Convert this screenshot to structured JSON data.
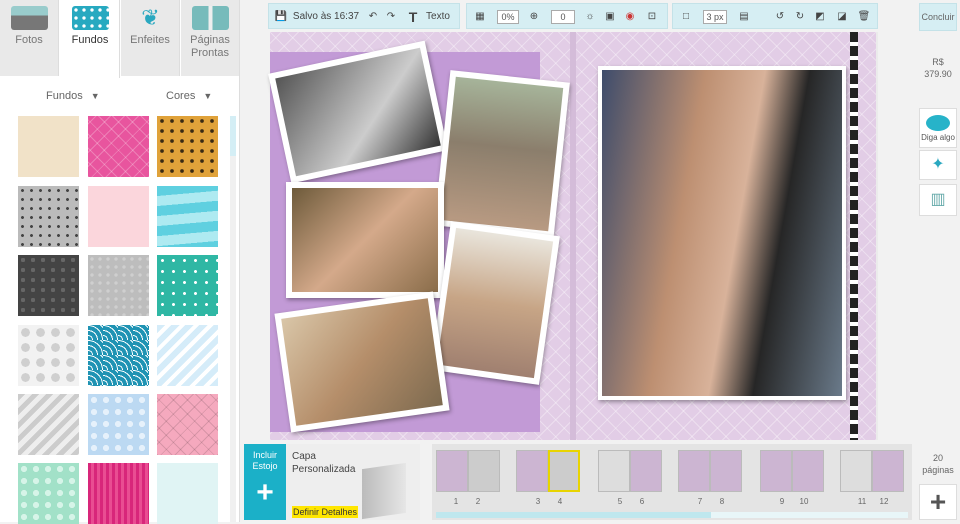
{
  "tabs": [
    {
      "label": "Fotos"
    },
    {
      "label": "Fundos"
    },
    {
      "label": "Enfeites"
    },
    {
      "label": "Páginas Prontas"
    }
  ],
  "filters": {
    "backgrounds": "Fundos",
    "colors": "Cores"
  },
  "toolbar": {
    "saved": "Salvo às 16:37",
    "text": "Texto",
    "opacity": "0%",
    "zoom": "0",
    "border": "3 px"
  },
  "concluir": "Concluir",
  "price": {
    "currency": "R$",
    "value": "379.90"
  },
  "say": "Diga algo",
  "bottom": {
    "include_line1": "Incluir",
    "include_line2": "Estojo",
    "include_plus": "+",
    "cover_title": "Capa Personalizada",
    "cover_link": "Definir Detalhes",
    "pages_count": "20",
    "pages_label": "páginas",
    "add_plus": "+"
  },
  "page_numbers": [
    "1",
    "2",
    "3",
    "4",
    "5",
    "6",
    "7",
    "8",
    "9",
    "10",
    "11",
    "12"
  ]
}
